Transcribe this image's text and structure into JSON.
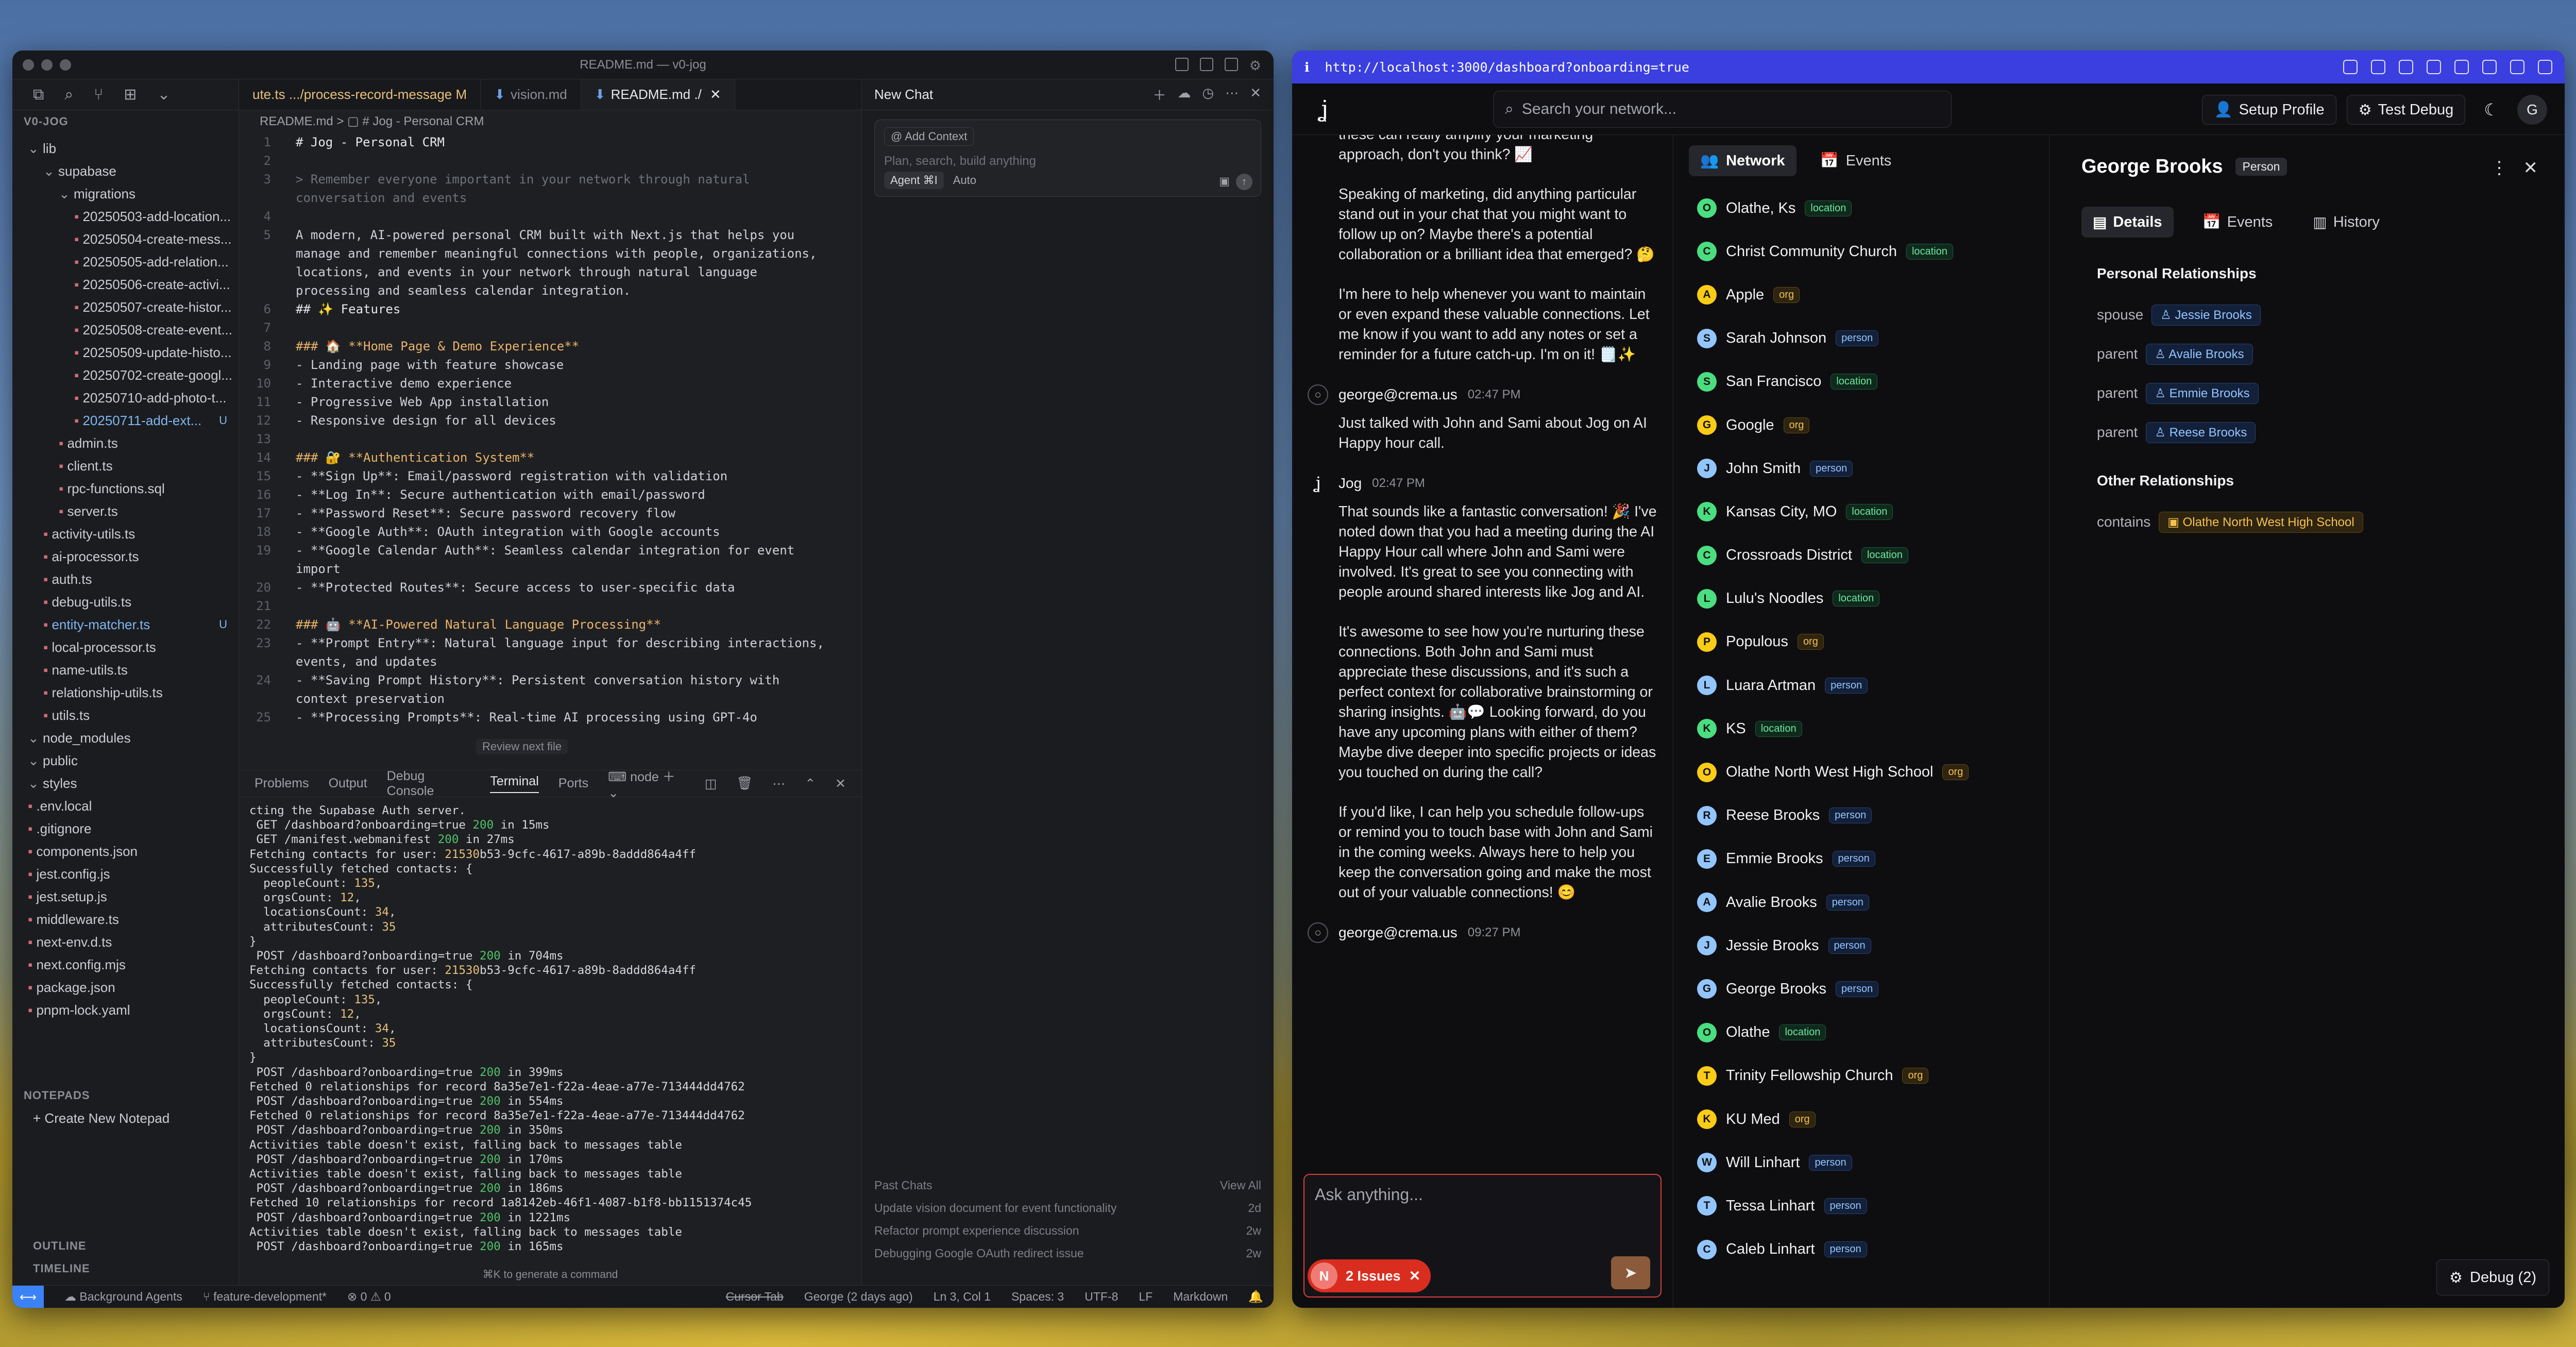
{
  "vscode": {
    "window_title": "README.md — v0-jog",
    "tabs": [
      {
        "label": "ute.ts .../process-record-message M"
      },
      {
        "label": "vision.md"
      },
      {
        "label": "README.md ./"
      }
    ],
    "breadcrumb": "README.md > ▢ # Jog - Personal CRM",
    "explorer_root": "V0-JOG",
    "tree": [
      {
        "label": "lib",
        "indent": 0,
        "folder": true,
        "tag": ""
      },
      {
        "label": "supabase",
        "indent": 1,
        "folder": true,
        "tag": ""
      },
      {
        "label": "migrations",
        "indent": 2,
        "folder": true,
        "tag": ""
      },
      {
        "label": "20250503-add-location...",
        "indent": 3,
        "tag": ""
      },
      {
        "label": "20250504-create-mess...",
        "indent": 3,
        "tag": ""
      },
      {
        "label": "20250505-add-relation...",
        "indent": 3,
        "tag": ""
      },
      {
        "label": "20250506-create-activi...",
        "indent": 3,
        "tag": ""
      },
      {
        "label": "20250507-create-histor...",
        "indent": 3,
        "tag": ""
      },
      {
        "label": "20250508-create-event...",
        "indent": 3,
        "tag": ""
      },
      {
        "label": "20250509-update-histo...",
        "indent": 3,
        "tag": ""
      },
      {
        "label": "20250702-create-googl...",
        "indent": 3,
        "tag": ""
      },
      {
        "label": "20250710-add-photo-t...",
        "indent": 3,
        "tag": ""
      },
      {
        "label": "20250711-add-ext...",
        "indent": 3,
        "tag": "U"
      },
      {
        "label": "admin.ts",
        "indent": 2,
        "tag": ""
      },
      {
        "label": "client.ts",
        "indent": 2,
        "tag": ""
      },
      {
        "label": "rpc-functions.sql",
        "indent": 2,
        "tag": ""
      },
      {
        "label": "server.ts",
        "indent": 2,
        "tag": ""
      },
      {
        "label": "activity-utils.ts",
        "indent": 1,
        "tag": ""
      },
      {
        "label": "ai-processor.ts",
        "indent": 1,
        "tag": ""
      },
      {
        "label": "auth.ts",
        "indent": 1,
        "tag": ""
      },
      {
        "label": "debug-utils.ts",
        "indent": 1,
        "tag": ""
      },
      {
        "label": "entity-matcher.ts",
        "indent": 1,
        "tag": "U"
      },
      {
        "label": "local-processor.ts",
        "indent": 1,
        "tag": ""
      },
      {
        "label": "name-utils.ts",
        "indent": 1,
        "tag": ""
      },
      {
        "label": "relationship-utils.ts",
        "indent": 1,
        "tag": ""
      },
      {
        "label": "utils.ts",
        "indent": 1,
        "tag": ""
      },
      {
        "label": "node_modules",
        "indent": 0,
        "folder": true,
        "tag": ""
      },
      {
        "label": "public",
        "indent": 0,
        "folder": true,
        "tag": ""
      },
      {
        "label": "styles",
        "indent": 0,
        "folder": true,
        "tag": ""
      },
      {
        "label": ".env.local",
        "indent": 0,
        "tag": ""
      },
      {
        "label": ".gitignore",
        "indent": 0,
        "tag": ""
      },
      {
        "label": "components.json",
        "indent": 0,
        "tag": ""
      },
      {
        "label": "jest.config.js",
        "indent": 0,
        "tag": ""
      },
      {
        "label": "jest.setup.js",
        "indent": 0,
        "tag": ""
      },
      {
        "label": "middleware.ts",
        "indent": 0,
        "tag": ""
      },
      {
        "label": "next-env.d.ts",
        "indent": 0,
        "tag": ""
      },
      {
        "label": "next.config.mjs",
        "indent": 0,
        "tag": ""
      },
      {
        "label": "package.json",
        "indent": 0,
        "tag": ""
      },
      {
        "label": "pnpm-lock.yaml",
        "indent": 0,
        "tag": ""
      }
    ],
    "notepads_label": "NOTEPADS",
    "create_notepad": "Create New Notepad",
    "outline_label": "OUTLINE",
    "timeline_label": "TIMELINE",
    "code_lines": [
      {
        "n": "1",
        "t": "# Jog - Personal CRM",
        "c": "hd"
      },
      {
        "n": "2",
        "t": "",
        "c": ""
      },
      {
        "n": "3",
        "t": "> Remember everyone important in your network through natural conversation and events",
        "c": "cmt"
      },
      {
        "n": "4",
        "t": "",
        "c": ""
      },
      {
        "n": "5",
        "t": "A modern, AI-powered personal CRM built with Next.js that helps you manage and remember meaningful connections with people, organizations, locations, and events in your network through natural language processing and seamless calendar integration.",
        "c": ""
      },
      {
        "n": "6",
        "t": "## ✨ Features",
        "c": "hd"
      },
      {
        "n": "7",
        "t": "",
        "c": ""
      },
      {
        "n": "8",
        "t": "### 🏠 **Home Page & Demo Experience**",
        "c": "bold"
      },
      {
        "n": "9",
        "t": "- Landing page with feature showcase",
        "c": ""
      },
      {
        "n": "10",
        "t": "- Interactive demo experience",
        "c": ""
      },
      {
        "n": "11",
        "t": "- Progressive Web App installation",
        "c": ""
      },
      {
        "n": "12",
        "t": "- Responsive design for all devices",
        "c": ""
      },
      {
        "n": "13",
        "t": "",
        "c": ""
      },
      {
        "n": "14",
        "t": "### 🔐 **Authentication System**",
        "c": "bold"
      },
      {
        "n": "15",
        "t": "- **Sign Up**: Email/password registration with validation",
        "c": ""
      },
      {
        "n": "16",
        "t": "- **Log In**: Secure authentication with email/password",
        "c": ""
      },
      {
        "n": "17",
        "t": "- **Password Reset**: Secure password recovery flow",
        "c": ""
      },
      {
        "n": "18",
        "t": "- **Google Auth**: OAuth integration with Google accounts",
        "c": ""
      },
      {
        "n": "19",
        "t": "- **Google Calendar Auth**: Seamless calendar integration for event import",
        "c": ""
      },
      {
        "n": "20",
        "t": "- **Protected Routes**: Secure access to user-specific data",
        "c": ""
      },
      {
        "n": "21",
        "t": "",
        "c": ""
      },
      {
        "n": "22",
        "t": "### 🤖 **AI-Powered Natural Language Processing**",
        "c": "bold"
      },
      {
        "n": "23",
        "t": "- **Prompt Entry**: Natural language input for describing interactions, events, and updates",
        "c": ""
      },
      {
        "n": "24",
        "t": "- **Saving Prompt History**: Persistent conversation history with context preservation",
        "c": ""
      },
      {
        "n": "25",
        "t": "- **Processing Prompts**: Real-time AI processing using GPT-4o",
        "c": ""
      }
    ],
    "review_hint": "Review next file",
    "terminal_tabs": [
      "Problems",
      "Output",
      "Debug Console",
      "Terminal",
      "Ports",
      "node"
    ],
    "terminal_output": "cting the Supabase Auth server.\n GET /dashboard?onboarding=true 200 in 15ms\n GET /manifest.webmanifest 200 in 27ms\nFetching contacts for user: 21530b53-9cfc-4617-a89b-8addd864a4ff\nSuccessfully fetched contacts: {\n  peopleCount: 135,\n  orgsCount: 12,\n  locationsCount: 34,\n  attributesCount: 35\n}\n POST /dashboard?onboarding=true 200 in 704ms\nFetching contacts for user: 21530b53-9cfc-4617-a89b-8addd864a4ff\nSuccessfully fetched contacts: {\n  peopleCount: 135,\n  orgsCount: 12,\n  locationsCount: 34,\n  attributesCount: 35\n}\n POST /dashboard?onboarding=true 200 in 399ms\nFetched 0 relationships for record 8a35e7e1-f22a-4eae-a77e-713444dd4762\n POST /dashboard?onboarding=true 200 in 554ms\nFetched 0 relationships for record 8a35e7e1-f22a-4eae-a77e-713444dd4762\n POST /dashboard?onboarding=true 200 in 350ms\nActivities table doesn't exist, falling back to messages table\n POST /dashboard?onboarding=true 200 in 170ms\nActivities table doesn't exist, falling back to messages table\n POST /dashboard?onboarding=true 200 in 186ms\nFetched 10 relationships for record 1a8142eb-46f1-4087-b1f8-bb1151374c45\n POST /dashboard?onboarding=true 200 in 1221ms\nActivities table doesn't exist, falling back to messages table\n POST /dashboard?onboarding=true 200 in 165ms",
    "generate_hint": "⌘K to generate a command",
    "chat_title": "New Chat",
    "add_context": "Add Context",
    "chat_placeholder": "Plan, search, build anything",
    "agent_label": "Agent ⌘I",
    "auto_label": "Auto",
    "past_chats_label": "Past Chats",
    "view_all": "View All",
    "past_chats": [
      {
        "title": "Update vision document for event functionality",
        "age": "2d"
      },
      {
        "title": "Refactor prompt experience discussion",
        "age": "2w"
      },
      {
        "title": "Debugging Google OAuth redirect issue",
        "age": "2w"
      }
    ],
    "status": {
      "background_agents": "Background Agents",
      "branch": "feature-development*",
      "problems": "⊗ 0 ⚠ 0",
      "cursor_tab": "Cursor Tab",
      "blame": "George (2 days ago)",
      "position": "Ln 3, Col 1",
      "spaces": "Spaces: 3",
      "encoding": "UTF-8",
      "eol": "LF",
      "language": "Markdown"
    }
  },
  "browser": {
    "url": "http://localhost:3000/dashboard?onboarding=true",
    "search_placeholder": "Search your network...",
    "setup_profile": "Setup Profile",
    "test_debug": "Test Debug",
    "avatar_letter": "G",
    "messages": [
      {
        "kind": "text",
        "text": "these can really amplify your marketing approach, don't you think? 📈"
      },
      {
        "kind": "text",
        "text": "Speaking of marketing, did anything particular stand out in your chat that you might want to follow up on? Maybe there's a potential collaboration or a brilliant idea that emerged? 🤔"
      },
      {
        "kind": "text",
        "text": "I'm here to help whenever you want to maintain or even expand these valuable connections. Let me know if you want to add any notes or set a reminder for a future catch-up. I'm on it! 🗒️✨"
      },
      {
        "kind": "user",
        "name": "george@crema.us",
        "time": "02:47 PM"
      },
      {
        "kind": "text",
        "text": "Just talked with John and Sami about Jog on AI Happy hour call."
      },
      {
        "kind": "bot",
        "name": "Jog",
        "time": "02:47 PM"
      },
      {
        "kind": "text",
        "text": "That sounds like a fantastic conversation! 🎉 I've noted down that you had a meeting during the AI Happy Hour call where John and Sami were involved. It's great to see you connecting with people around shared interests like Jog and AI."
      },
      {
        "kind": "text",
        "text": "It's awesome to see how you're nurturing these connections. Both John and Sami must appreciate these discussions, and it's such a perfect context for collaborative brainstorming or sharing insights. 🤖💬 Looking forward, do you have any upcoming plans with either of them? Maybe dive deeper into specific projects or ideas you touched on during the call?"
      },
      {
        "kind": "text",
        "text": "If you'd like, I can help you schedule follow-ups or remind you to touch base with John and Sami in the coming weeks. Always here to help you keep the conversation going and make the most out of your valuable connections! 😊"
      },
      {
        "kind": "user",
        "name": "george@crema.us",
        "time": "09:27 PM"
      }
    ],
    "ask_placeholder": "Ask anything...",
    "issues_label": "2 Issues",
    "issues_avatar": "N",
    "net_tabs": [
      "Network",
      "Events"
    ],
    "network": [
      {
        "name": "Olathe, Ks",
        "type": "location"
      },
      {
        "name": "Christ Community Church",
        "type": "location"
      },
      {
        "name": "Apple",
        "type": "org"
      },
      {
        "name": "Sarah Johnson",
        "type": "person"
      },
      {
        "name": "San Francisco",
        "type": "location"
      },
      {
        "name": "Google",
        "type": "org"
      },
      {
        "name": "John Smith",
        "type": "person"
      },
      {
        "name": "Kansas City, MO",
        "type": "location"
      },
      {
        "name": "Crossroads District",
        "type": "location"
      },
      {
        "name": "Lulu's Noodles",
        "type": "location"
      },
      {
        "name": "Populous",
        "type": "org"
      },
      {
        "name": "Luara Artman",
        "type": "person"
      },
      {
        "name": "KS",
        "type": "location"
      },
      {
        "name": "Olathe North West High School",
        "type": "org"
      },
      {
        "name": "Reese Brooks",
        "type": "person"
      },
      {
        "name": "Emmie Brooks",
        "type": "person"
      },
      {
        "name": "Avalie Brooks",
        "type": "person"
      },
      {
        "name": "Jessie Brooks",
        "type": "person"
      },
      {
        "name": "George Brooks",
        "type": "person"
      },
      {
        "name": "Olathe",
        "type": "location"
      },
      {
        "name": "Trinity Fellowship Church",
        "type": "org"
      },
      {
        "name": "KU Med",
        "type": "org"
      },
      {
        "name": "Will Linhart",
        "type": "person"
      },
      {
        "name": "Tessa Linhart",
        "type": "person"
      },
      {
        "name": "Caleb Linhart",
        "type": "person"
      }
    ],
    "detail": {
      "name": "George Brooks",
      "type_tag": "Person",
      "tabs": [
        "Details",
        "Events",
        "History"
      ],
      "personal_title": "Personal Relationships",
      "personal": [
        {
          "rel": "spouse",
          "name": "Jessie Brooks"
        },
        {
          "rel": "parent",
          "name": "Avalie Brooks"
        },
        {
          "rel": "parent",
          "name": "Emmie Brooks"
        },
        {
          "rel": "parent",
          "name": "Reese Brooks"
        }
      ],
      "other_title": "Other Relationships",
      "other": [
        {
          "rel": "contains",
          "name": "Olathe North West High School"
        }
      ]
    },
    "debug_label": "Debug (2)"
  }
}
